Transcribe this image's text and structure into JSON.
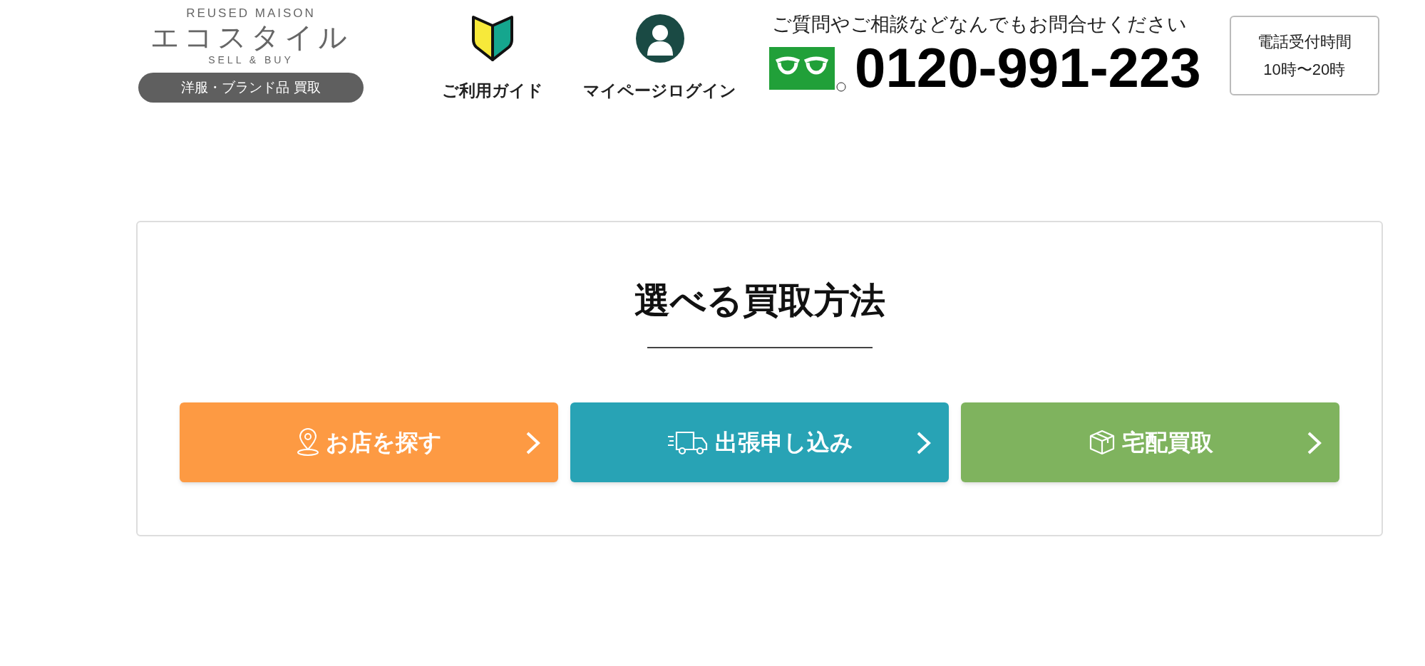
{
  "header": {
    "logo": {
      "top": "REUSED MAISON",
      "name": "エコスタイル",
      "bottom": "SELL & BUY",
      "tagline": "洋服・ブランド品 買取"
    },
    "nav": [
      {
        "kind": "guide",
        "label": "ご利用ガイド"
      },
      {
        "kind": "login",
        "label": "マイページログイン"
      }
    ],
    "contact": {
      "lead": "ご質問やご相談などなんでもお問合せください",
      "phone": "0120-991-223",
      "hours_title": "電話受付時間",
      "hours": "10時〜20時"
    }
  },
  "section": {
    "title": "選べる買取方法",
    "buttons": [
      {
        "kind": "store",
        "label": "お店を探す",
        "color": "#fd9a43"
      },
      {
        "kind": "visit",
        "label": "出張申し込み",
        "color": "#28a3b5"
      },
      {
        "kind": "delivery",
        "label": "宅配買取",
        "color": "#7fb35e"
      }
    ]
  }
}
